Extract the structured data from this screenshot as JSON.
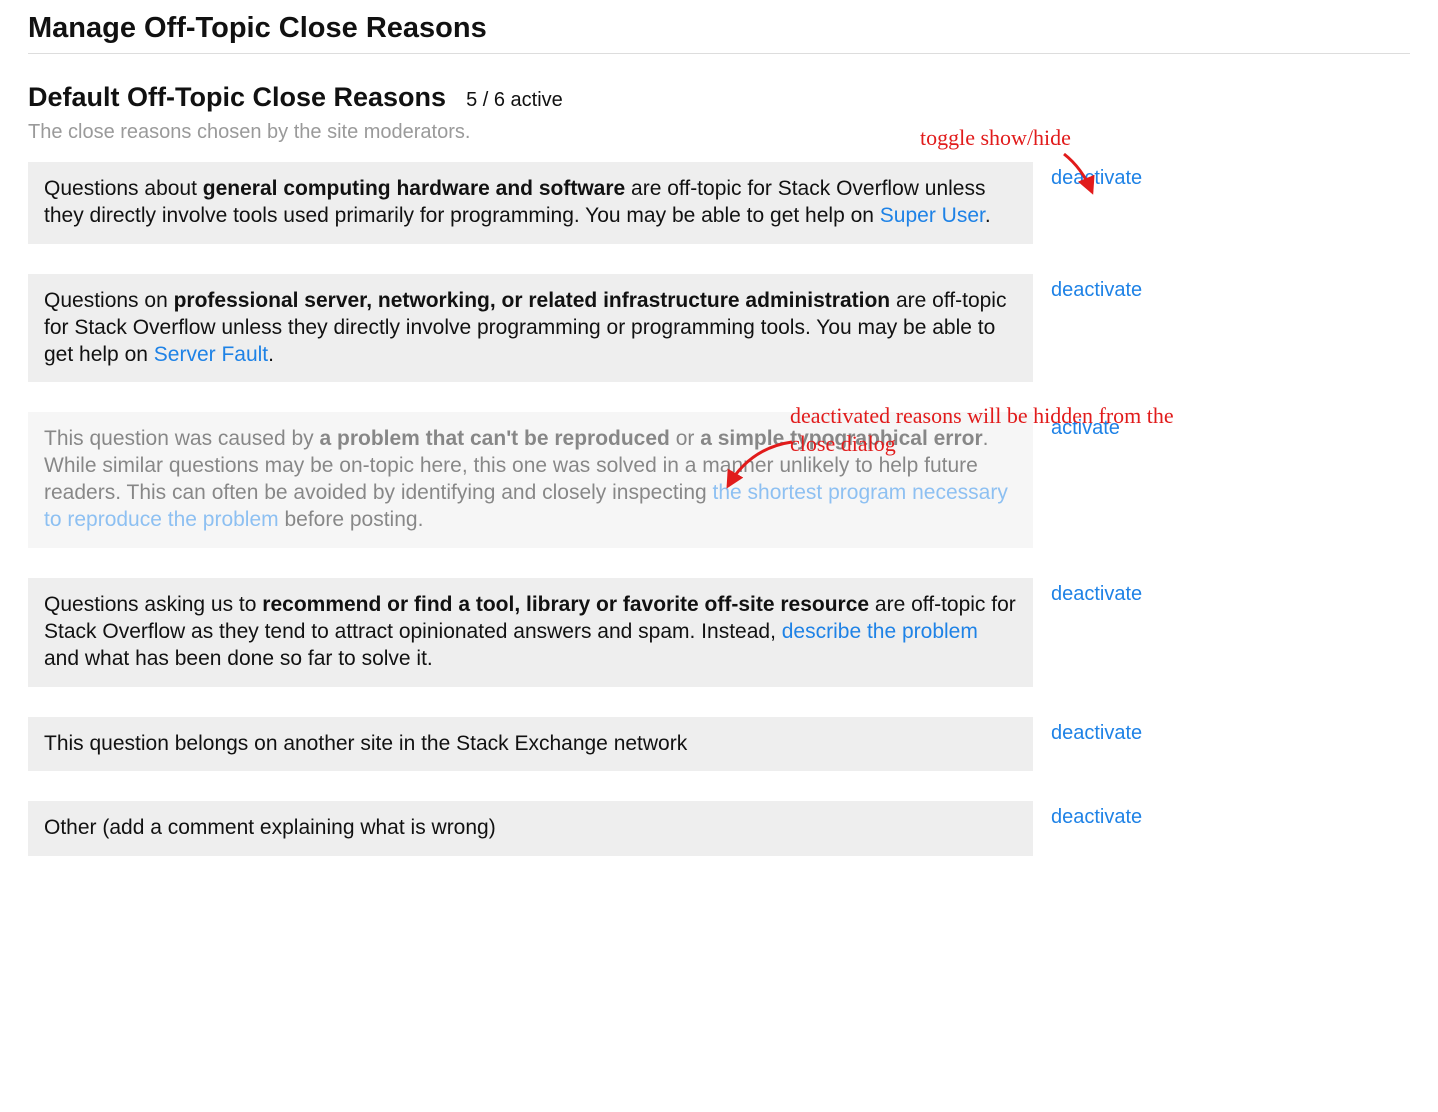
{
  "page_title": "Manage Off-Topic Close Reasons",
  "section": {
    "title": "Default Off-Topic Close Reasons",
    "active_count": "5 / 6 active",
    "subtitle": "The close reasons chosen by the site moderators."
  },
  "actions": {
    "deactivate": "deactivate",
    "activate": "activate"
  },
  "reasons": [
    {
      "pre": "Questions about ",
      "bold1": "general computing hardware and software",
      "mid": " are off-topic for Stack Overflow unless they directly involve tools used primarily for programming. You may be able to get help on ",
      "link1": "Super User",
      "post": ".",
      "action": "deactivate",
      "active": true
    },
    {
      "pre": "Questions on ",
      "bold1": "professional server, networking, or related infrastructure administration",
      "mid": " are off-topic for Stack Overflow unless they directly involve programming or programming tools. You may be able to get help on ",
      "link1": "Server Fault",
      "post": ".",
      "action": "deactivate",
      "active": true
    },
    {
      "pre": "This question was caused by ",
      "bold1": "a problem that can't be reproduced",
      "mid": " or ",
      "bold2": "a simple typographical error",
      "mid2": ". While similar questions may be on-topic here, this one was solved in a manner unlikely to help future readers. This can often be avoided by identifying and closely inspecting ",
      "link1": "the shortest program necessary to reproduce the problem",
      "post": " before posting.",
      "action": "activate",
      "active": false
    },
    {
      "pre": "Questions asking us to ",
      "bold1": "recommend or find a tool, library or favorite off-site resource",
      "mid": " are off-topic for Stack Overflow as they tend to attract opinionated answers and spam. Instead, ",
      "link1": "describe the problem",
      "post": " and what has been done so far to solve it.",
      "action": "deactivate",
      "active": true
    },
    {
      "pre": "This question belongs on another site in the Stack Exchange network",
      "action": "deactivate",
      "active": true
    },
    {
      "pre": "Other (add a comment explaining what is wrong)",
      "action": "deactivate",
      "active": true
    }
  ],
  "annotations": {
    "top": "toggle show/hide",
    "mid": "deactivated reasons will be hidden from the close dialog"
  }
}
